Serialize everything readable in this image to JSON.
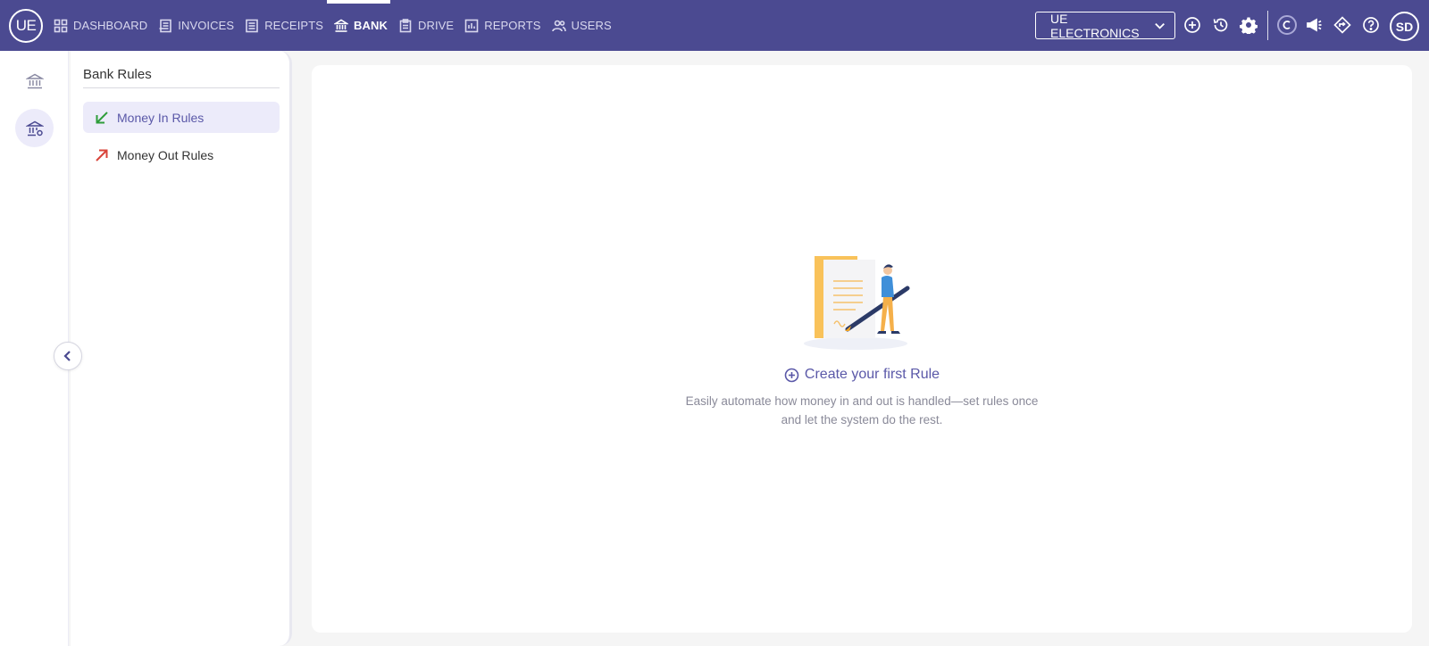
{
  "app": {
    "logo_text": "UE",
    "user_initials": "SD",
    "company": "UE ELECTRONICS"
  },
  "nav": {
    "dashboard": "DASHBOARD",
    "invoices": "INVOICES",
    "receipts": "RECEIPTS",
    "bank": "BANK",
    "drive": "DRIVE",
    "reports": "REPORTS",
    "users": "USERS"
  },
  "top_icons": [
    "add-circle-icon",
    "history-icon",
    "settings-gear-icon",
    "c-badge-icon",
    "megaphone-icon",
    "diamond-arrow-icon",
    "help-icon"
  ],
  "panel": {
    "title": "Bank Rules",
    "items": [
      {
        "label": "Money In Rules",
        "icon": "arrow-down-left-icon",
        "color": "#2e9d3a"
      },
      {
        "label": "Money Out Rules",
        "icon": "arrow-up-right-icon",
        "color": "#d9443a"
      }
    ]
  },
  "empty_state": {
    "cta": "Create your first Rule",
    "description": "Easily automate how money in and out is handled—set rules once and let the system do the rest."
  },
  "colors": {
    "brand": "#4b4a91",
    "accent": "#5a58a8",
    "active_bg": "#ecebfa"
  }
}
